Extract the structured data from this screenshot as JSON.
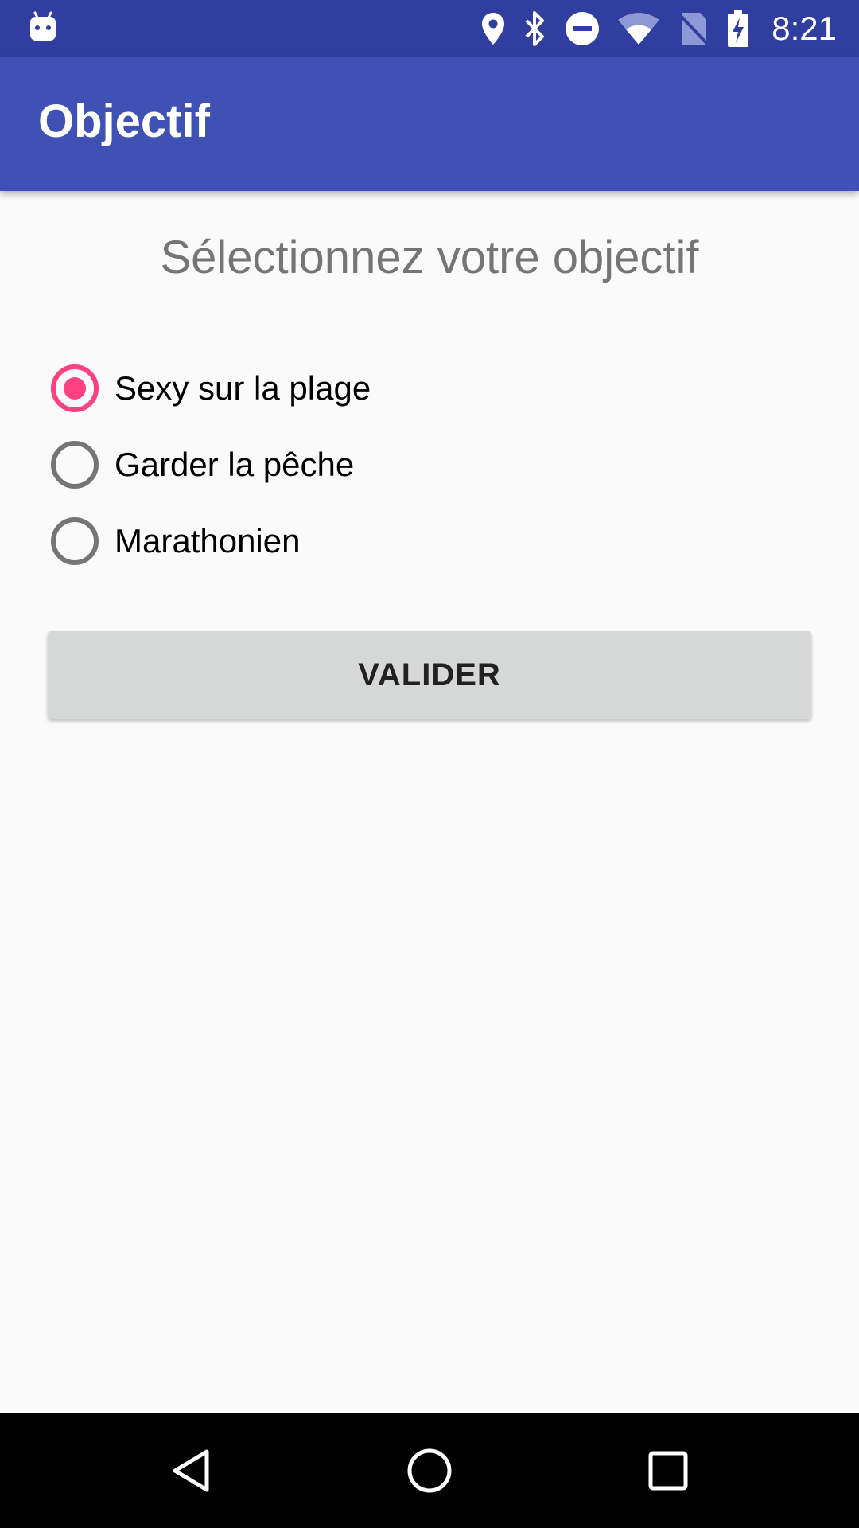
{
  "status_bar": {
    "time": "8:21",
    "icons": [
      "android-notification-icon",
      "location-icon",
      "bluetooth-icon",
      "do-not-disturb-icon",
      "wifi-icon",
      "no-sim-icon",
      "battery-charging-icon"
    ],
    "color": "#303f9f"
  },
  "app_bar": {
    "title": "Objectif",
    "color": "#3f51b5"
  },
  "main": {
    "heading": "Sélectionnez votre objectif",
    "options": [
      {
        "label": "Sexy sur la plage",
        "checked": true
      },
      {
        "label": "Garder la pêche",
        "checked": false
      },
      {
        "label": "Marathonien",
        "checked": false
      }
    ],
    "accent_color": "#ff4081",
    "submit_label": "VALIDER"
  },
  "nav_bar": {
    "buttons": [
      "back-icon",
      "home-icon",
      "recents-icon"
    ]
  }
}
